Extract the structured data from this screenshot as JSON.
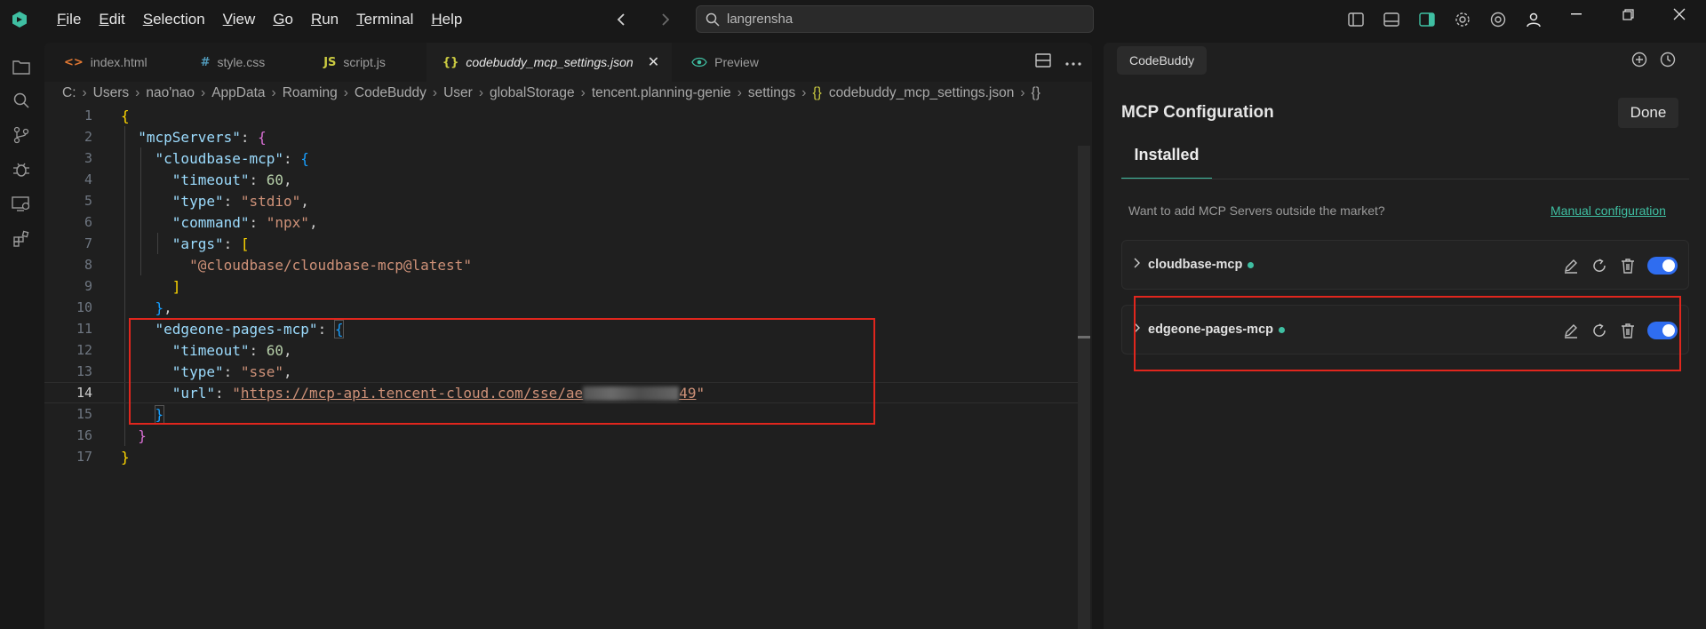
{
  "menu": {
    "items": [
      {
        "label": "File",
        "mnemonic": "F",
        "rest": "ile"
      },
      {
        "label": "Edit",
        "mnemonic": "E",
        "rest": "dit"
      },
      {
        "label": "Selection",
        "mnemonic": "S",
        "rest": "election"
      },
      {
        "label": "View",
        "mnemonic": "V",
        "rest": "iew"
      },
      {
        "label": "Go",
        "mnemonic": "G",
        "rest": "o"
      },
      {
        "label": "Run",
        "mnemonic": "R",
        "rest": "un"
      },
      {
        "label": "Terminal",
        "mnemonic": "T",
        "rest": "erminal"
      },
      {
        "label": "Help",
        "mnemonic": "H",
        "rest": "elp"
      }
    ]
  },
  "search": {
    "value": "langrensha"
  },
  "tabs": [
    {
      "label": "index.html",
      "icon": "<>",
      "icon_color": "#e37933"
    },
    {
      "label": "style.css",
      "icon": "#",
      "icon_color": "#519aba"
    },
    {
      "label": "script.js",
      "icon": "JS",
      "icon_color": "#cbcb41"
    },
    {
      "label": "codebuddy_mcp_settings.json",
      "icon": "{}",
      "icon_color": "#cbcb41",
      "active": true
    },
    {
      "label": "Preview",
      "icon": "eye-icon",
      "icon_color": "#3fbfa2"
    }
  ],
  "breadcrumb": [
    "C:",
    "Users",
    "nao'nao",
    "AppData",
    "Roaming",
    "CodeBuddy",
    "User",
    "globalStorage",
    "tencent.planning-genie",
    "settings",
    "codebuddy_mcp_settings.json",
    "{}"
  ],
  "code": {
    "line_numbers": [
      "1",
      "2",
      "3",
      "4",
      "5",
      "6",
      "7",
      "8",
      "9",
      "10",
      "11",
      "12",
      "13",
      "14",
      "15",
      "16",
      "17"
    ],
    "current_line": 14,
    "k_mcpServers": "\"mcpServers\"",
    "k_cloudbase": "\"cloudbase-mcp\"",
    "k_timeout": "\"timeout\"",
    "v_60": "60",
    "k_type": "\"type\"",
    "v_stdio": "\"stdio\"",
    "k_command": "\"command\"",
    "v_npx": "\"npx\"",
    "k_args": "\"args\"",
    "v_arg": "\"@cloudbase/cloudbase-mcp@latest\"",
    "k_edgeone": "\"edgeone-pages-mcp\"",
    "v_sse": "\"sse\"",
    "k_url": "\"url\"",
    "v_url_start": "\"",
    "v_url_a": "https://mcp-api.tencent-cloud.com/sse/ae",
    "v_url_b": "49",
    "v_url_end": "\""
  },
  "panel": {
    "tab_label": "CodeBuddy",
    "title": "MCP Configuration",
    "done_label": "Done",
    "installed_label": "Installed",
    "hint": "Want to add MCP Servers outside the market?",
    "manual_link": "Manual configuration",
    "servers": [
      {
        "name": "cloudbase-mcp",
        "enabled": true
      },
      {
        "name": "edgeone-pages-mcp",
        "enabled": true
      }
    ]
  },
  "colors": {
    "accent": "#3fbfa2",
    "toggle": "#2f6df0",
    "highlight_box": "#e0261d"
  }
}
